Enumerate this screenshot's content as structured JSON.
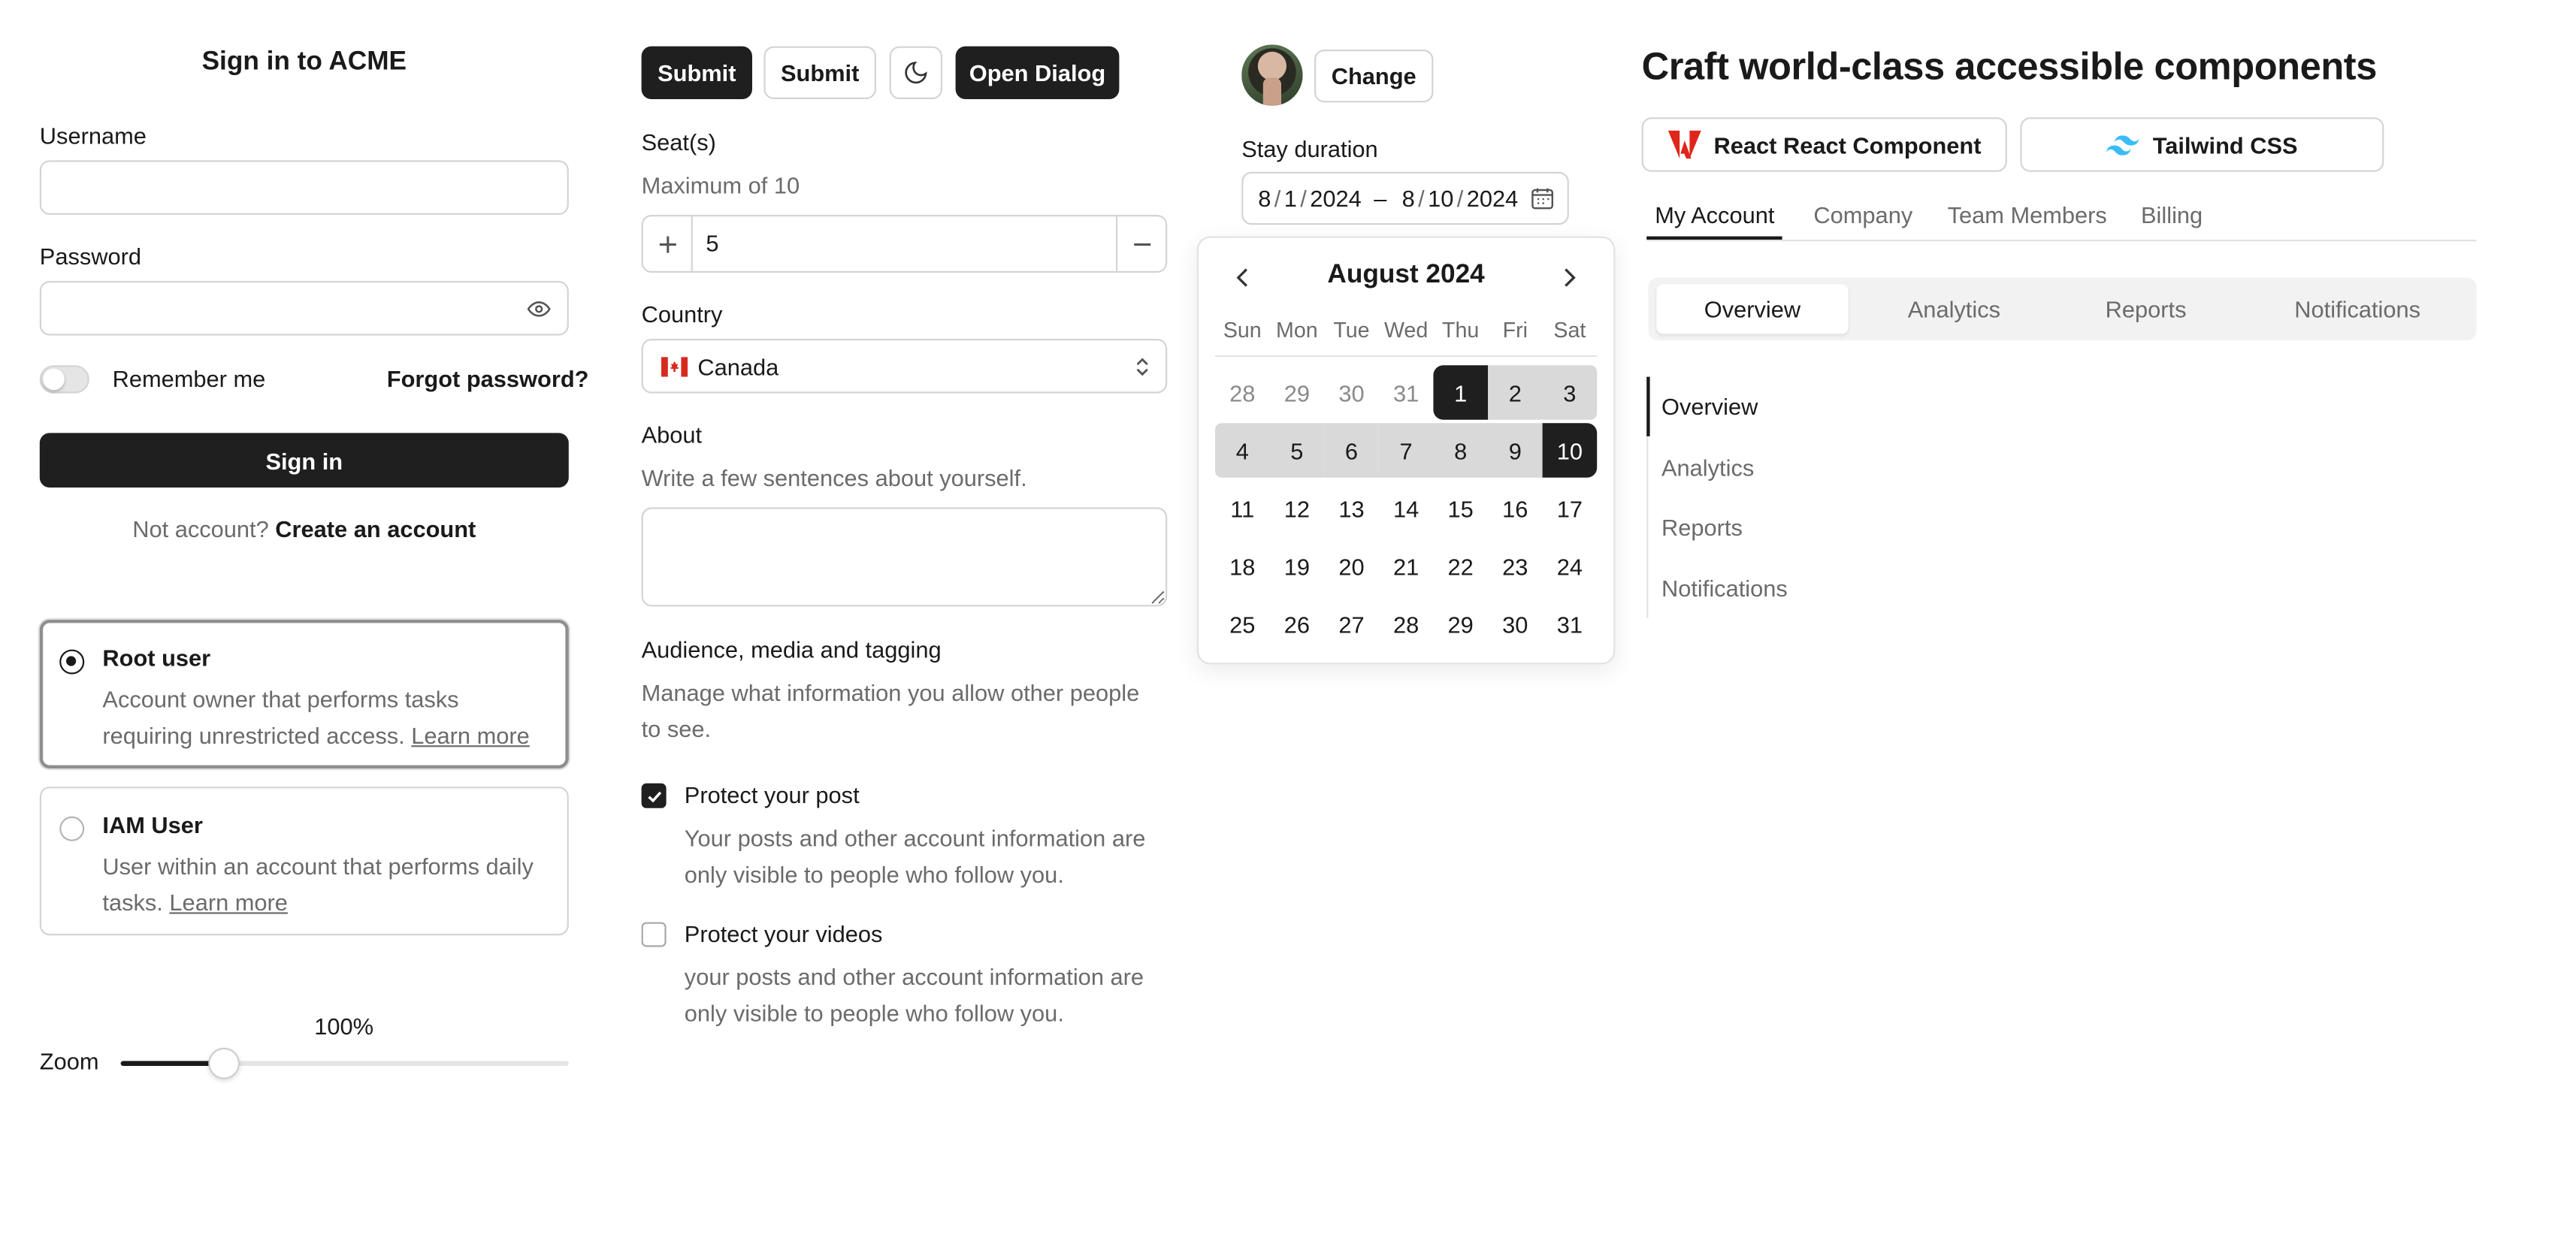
{
  "signin": {
    "title": "Sign in to ACME",
    "username_label": "Username",
    "username_value": "",
    "password_label": "Password",
    "password_value": "",
    "remember_label": "Remember me",
    "forgot_label": "Forgot password?",
    "signin_button": "Sign in",
    "no_account_text": "Not account?",
    "create_account_link": "Create an account"
  },
  "user_type": {
    "selected": "Root user",
    "options": [
      {
        "title": "Root user",
        "description": "Account owner that performs tasks requiring unrestricted access.",
        "link": "Learn more"
      },
      {
        "title": "IAM User",
        "description": "User within an account that performs daily tasks.",
        "link": "Learn more"
      }
    ]
  },
  "zoom": {
    "label": "Zoom",
    "value_text": "100%",
    "fraction": 0.23
  },
  "toolbar": {
    "submit_primary": "Submit",
    "submit_secondary": "Submit",
    "theme_icon": "moon-icon",
    "open_dialog": "Open Dialog"
  },
  "seats": {
    "label": "Seat(s)",
    "hint": "Maximum of 10",
    "value": "5",
    "increment_icon": "plus-icon",
    "decrement_icon": "minus-icon"
  },
  "country": {
    "label": "Country",
    "value": "Canada",
    "flag_icon": "canada-flag-icon"
  },
  "about": {
    "label": "About",
    "hint": "Write a few sentences about yourself.",
    "value": ""
  },
  "audience": {
    "title": "Audience, media and tagging",
    "description": "Manage what information you allow other people to see.",
    "options": [
      {
        "label": "Protect your post",
        "checked": true,
        "description": "Your posts and other account information are only visible to people who follow you."
      },
      {
        "label": "Protect your videos",
        "checked": false,
        "description": "your posts and other account information are only visible to people who follow you."
      }
    ]
  },
  "avatar": {
    "change_button": "Change"
  },
  "stay": {
    "label": "Stay duration",
    "start": {
      "m": "8",
      "d": "1",
      "y": "2024"
    },
    "end": {
      "m": "8",
      "d": "10",
      "y": "2024"
    },
    "separator": "–"
  },
  "calendar": {
    "month_label": "August 2024",
    "weekdays": [
      "Sun",
      "Mon",
      "Tue",
      "Wed",
      "Thu",
      "Fri",
      "Sat"
    ],
    "weeks": [
      [
        "28",
        "29",
        "30",
        "31",
        "1",
        "2",
        "3"
      ],
      [
        "4",
        "5",
        "6",
        "7",
        "8",
        "9",
        "10"
      ],
      [
        "11",
        "12",
        "13",
        "14",
        "15",
        "16",
        "17"
      ],
      [
        "18",
        "19",
        "20",
        "21",
        "22",
        "23",
        "24"
      ],
      [
        "25",
        "26",
        "27",
        "28",
        "29",
        "30",
        "31"
      ]
    ],
    "range_start": "1",
    "range_end": "10"
  },
  "hero": {
    "title": "Craft world-class accessible components",
    "buttons": [
      {
        "label": "React React Component",
        "icon": "adobe-logo-icon"
      },
      {
        "label": "Tailwind CSS",
        "icon": "tailwind-logo-icon"
      }
    ]
  },
  "account_tabs": {
    "items": [
      "My Account",
      "Company",
      "Team Members",
      "Billing"
    ],
    "selected": "My Account"
  },
  "segmented_tabs": {
    "items": [
      "Overview",
      "Analytics",
      "Reports",
      "Notifications"
    ],
    "selected": "Overview"
  },
  "vertical_tabs": {
    "items": [
      "Overview",
      "Analytics",
      "Reports",
      "Notifications"
    ],
    "selected": "Overview"
  },
  "colors": {
    "accent_dark": "#1f1f1f",
    "range_fill": "#d9d9d9",
    "border": "#d4d4d4",
    "muted_text": "#6b6b6b"
  }
}
